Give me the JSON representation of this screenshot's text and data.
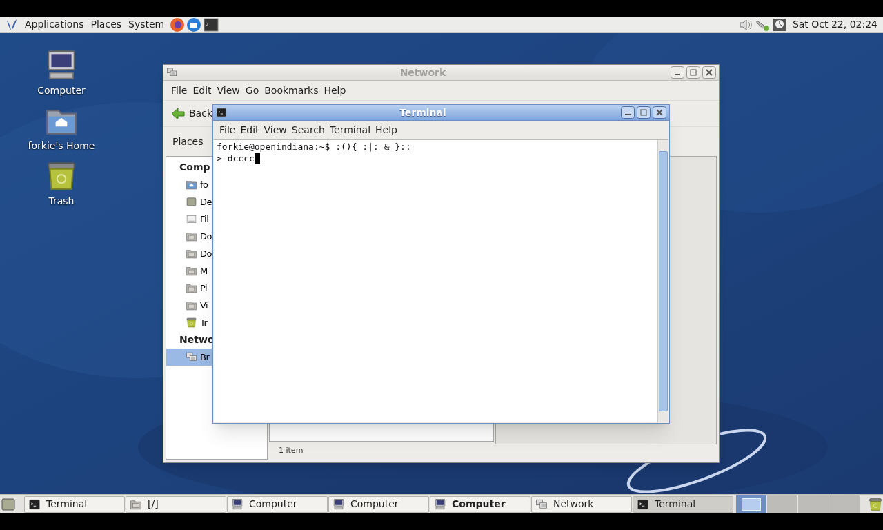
{
  "top_panel": {
    "menus": [
      {
        "label": "Applications"
      },
      {
        "label": "Places"
      },
      {
        "label": "System"
      }
    ],
    "clock": "Sat Oct 22, 02:24"
  },
  "desktop_icons": [
    {
      "label": "Computer",
      "kind": "computer"
    },
    {
      "label": "forkie's Home",
      "kind": "home"
    },
    {
      "label": "Trash",
      "kind": "trash"
    }
  ],
  "network_window": {
    "title": "Network",
    "active": false,
    "menu": [
      "File",
      "Edit",
      "View",
      "Go",
      "Bookmarks",
      "Help"
    ],
    "back": "Back",
    "places_label": "Places",
    "sidebar": [
      {
        "heading": "Comp",
        "items": [
          {
            "label": "fo",
            "kind": "home",
            "selected": false
          },
          {
            "label": "De",
            "kind": "desktop",
            "selected": false
          },
          {
            "label": "Fil",
            "kind": "drive",
            "selected": false
          },
          {
            "label": "Do",
            "kind": "folder",
            "selected": false
          },
          {
            "label": "Do",
            "kind": "folder",
            "selected": false
          },
          {
            "label": "M",
            "kind": "folder",
            "selected": false
          },
          {
            "label": "Pi",
            "kind": "folder",
            "selected": false
          },
          {
            "label": "Vi",
            "kind": "folder",
            "selected": false
          },
          {
            "label": "Tr",
            "kind": "trash",
            "selected": false
          }
        ]
      },
      {
        "heading": "Netwo",
        "items": [
          {
            "label": "Br",
            "kind": "network",
            "selected": true
          }
        ]
      }
    ],
    "status": "1 item"
  },
  "terminal_window": {
    "title": "Terminal",
    "active": true,
    "menu": [
      "File",
      "Edit",
      "View",
      "Search",
      "Terminal",
      "Help"
    ],
    "lines": [
      "forkie@openindiana:~$ :(){ :|: & }::",
      "> dcccc"
    ]
  },
  "taskbar": {
    "tasks": [
      {
        "label": "Terminal",
        "kind": "terminal",
        "selected": false,
        "attention": false
      },
      {
        "label": "[/]",
        "kind": "folder",
        "selected": false,
        "attention": false
      },
      {
        "label": "Computer",
        "kind": "computer",
        "selected": false,
        "attention": false
      },
      {
        "label": "Computer",
        "kind": "computer",
        "selected": false,
        "attention": false
      },
      {
        "label": "Computer",
        "kind": "computer",
        "selected": false,
        "attention": true
      },
      {
        "label": "Network",
        "kind": "network",
        "selected": false,
        "attention": false
      },
      {
        "label": "Terminal",
        "kind": "terminal",
        "selected": true,
        "attention": false
      }
    ],
    "workspaces": [
      {
        "selected": true
      },
      {
        "selected": false
      },
      {
        "selected": false
      },
      {
        "selected": false
      }
    ]
  }
}
